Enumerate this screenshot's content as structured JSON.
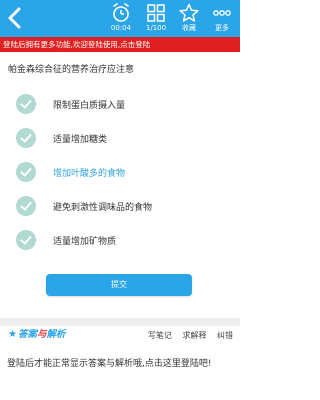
{
  "toolbar": {
    "timer": "00:04",
    "progress": "1/100",
    "favorite": "收藏",
    "more": "更多"
  },
  "banner": "登陆后拥有更多功能,欢迎登陆使用,点击登陆",
  "question": "帕金森综合征的营养治疗应注意",
  "options": [
    "限制蛋白质摄入量",
    "适量增加糖类",
    "增加叶酸多的食物",
    "避免刺激性调味品的食物",
    "适量增加矿物质"
  ],
  "submit_label": "提交",
  "answer": {
    "star": "★",
    "title_a": "答案",
    "title_b": "与",
    "title_c": "解析",
    "links": [
      "写笔记",
      "求解释",
      "纠错"
    ],
    "body": "登陆后才能正常显示答案与解析哦,点击这里登陆吧!"
  },
  "colors": {
    "primary": "#2aa5e8",
    "banner_red": "#e02020",
    "check_circle": "#b1dad2",
    "highlight_text": "#2fa3e2"
  }
}
